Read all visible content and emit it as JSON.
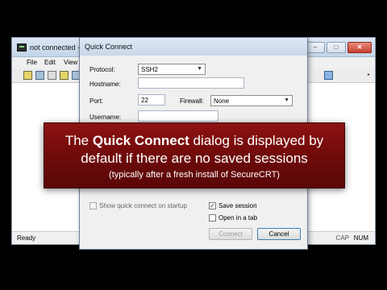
{
  "main_window": {
    "title": "not connected -",
    "caption_buttons": {
      "minimize": "–",
      "maximize": "□",
      "close": "✕"
    },
    "menu": [
      "File",
      "Edit",
      "View"
    ],
    "status": {
      "ready": "Ready",
      "cap": "CAP",
      "num": "NUM"
    }
  },
  "dialog": {
    "title": "Quick Connect",
    "protocol": {
      "label": "Protocol:",
      "value": "SSH2"
    },
    "hostname": {
      "label": "Hostname:",
      "value": ""
    },
    "port": {
      "label": "Port:",
      "value": "22"
    },
    "firewall": {
      "label": "Firewall:",
      "value": "None"
    },
    "username": {
      "label": "Username:",
      "value": ""
    },
    "show_on_startup": {
      "label": "Show quick connect on startup",
      "checked": false
    },
    "save_session": {
      "label": "Save session",
      "checked": true
    },
    "open_in_tab": {
      "label": "Open in a tab",
      "checked": false
    },
    "connect_button": "Connect",
    "cancel_button": "Cancel"
  },
  "overlay": {
    "line1_prefix": "The ",
    "line1_bold": "Quick Connect",
    "line1_suffix": " dialog is displayed by",
    "line2": "default if there are no saved sessions",
    "line3": "(typically after a fresh install of SecureCRT)"
  },
  "colors": {
    "banner": "#7a0c0c",
    "background": "#000000"
  }
}
